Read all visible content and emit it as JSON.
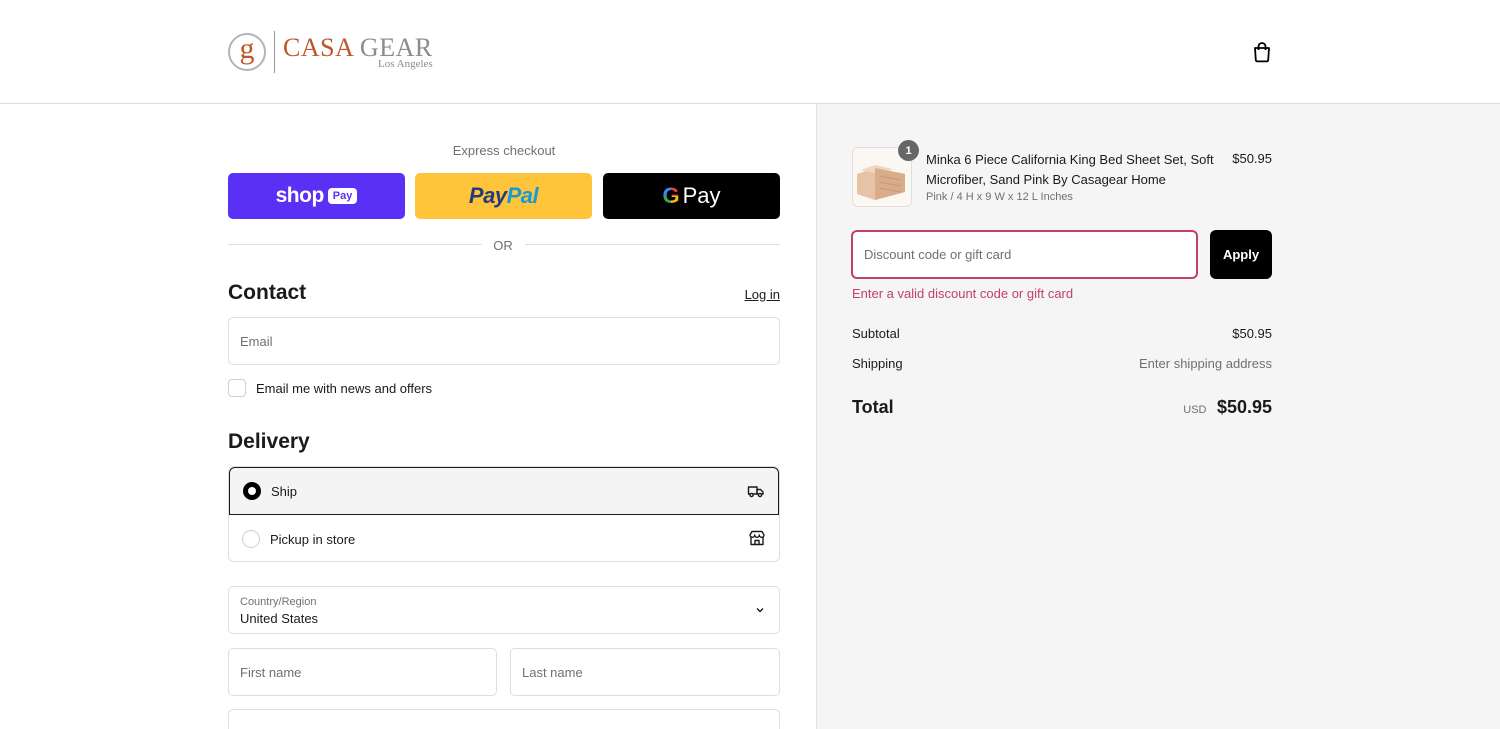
{
  "brand": {
    "initial": "g",
    "name_part1": "CASA",
    "name_part2": "GEAR",
    "subtitle": "Los Angeles"
  },
  "express": {
    "title": "Express checkout",
    "shop_label": "shop",
    "shop_badge": "Pay",
    "paypal_part1": "Pay",
    "paypal_part2": "Pal",
    "gpay_g": "G",
    "gpay_label": "Pay",
    "or_label": "OR"
  },
  "contact": {
    "title": "Contact",
    "login_label": "Log in",
    "email_placeholder": "Email",
    "news_label": "Email me with news and offers"
  },
  "delivery": {
    "title": "Delivery",
    "options": [
      {
        "label": "Ship",
        "selected": true,
        "icon": "truck-icon"
      },
      {
        "label": "Pickup in store",
        "selected": false,
        "icon": "store-icon"
      }
    ],
    "country_label": "Country/Region",
    "country_value": "United States",
    "first_name_placeholder": "First name",
    "last_name_placeholder": "Last name"
  },
  "cart": {
    "item": {
      "quantity": "1",
      "name": "Minka 6 Piece California King Bed Sheet Set, Soft Microfiber, Sand Pink By Casagear Home",
      "variant": "Pink / 4 H x 9 W x 12 L Inches",
      "price": "$50.95"
    },
    "discount_placeholder": "Discount code or gift card",
    "apply_label": "Apply",
    "discount_error": "Enter a valid discount code or gift card",
    "subtotal_label": "Subtotal",
    "subtotal_value": "$50.95",
    "shipping_label": "Shipping",
    "shipping_value": "Enter shipping address",
    "total_label": "Total",
    "total_currency": "USD",
    "total_value": "$50.95"
  },
  "colors": {
    "shop_purple": "#5a31f4",
    "paypal_yellow": "#ffc439",
    "error_pink": "#c23e6e",
    "brand_orange": "#c0572a"
  }
}
